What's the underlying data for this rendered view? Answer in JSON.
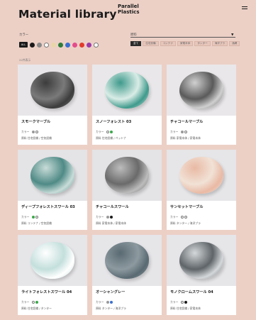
{
  "header": {
    "title": "Material library",
    "logo_line1": "Parallel",
    "logo_line2": "Plastics"
  },
  "filters": {
    "colors_label": "カラー",
    "all_label": "ALL",
    "swatches": [
      "#1a1a1a",
      "#8a8a8a",
      "#ffffff",
      "#e8d6a8",
      "#2e7d3a",
      "#3b6fd0",
      "#e44c8c",
      "#e23a2b",
      "#9b3aa8",
      "#ffffff"
    ],
    "material_label": "原料",
    "material_chips": [
      "全て",
      "住宅設備",
      "コンテナ",
      "家電本体",
      "タンター",
      "海洋プラ",
      "漁網"
    ],
    "result_count": "22件表示"
  },
  "cards": [
    {
      "name": "スモークマーブル",
      "color_label": "カラー",
      "dots": [
        "#999999",
        "#ffffff"
      ],
      "material": "原料  住宅設備 / 空気設備",
      "stone": "#7a7a7a",
      "stone2": "#3c3c3c",
      "bg": "#e8e6e9"
    },
    {
      "name": "スノーフォレスト 03",
      "color_label": "カラー",
      "dots": [
        "#ffffff",
        "#3aa84a"
      ],
      "material": "原料  住宅設備 / ペットナ",
      "stone": "#d9ece6",
      "stone2": "#3f9a8c",
      "bg": "#e9e7e9"
    },
    {
      "name": "チャコールマーブル",
      "color_label": "カラー",
      "dots": [
        "#999999",
        "#ffffff"
      ],
      "material": "原料  家電本体 / 家電本体",
      "stone": "#5a5a5a",
      "stone2": "#d0d0d0",
      "bg": "#e9e7e9"
    },
    {
      "name": "ディープフォレストスワール 03",
      "color_label": "カラー",
      "dots": [
        "#3aa84a",
        "#ffffff"
      ],
      "material": "原料  コンテナ / 空気設備",
      "stone": "#4f8a86",
      "stone2": "#c8dcd8",
      "bg": "#e4e3e6"
    },
    {
      "name": "チャコールスワール",
      "color_label": "カラー",
      "dots": [
        "#999999",
        "#1a1a1a"
      ],
      "material": "原料  家電本体 / 家電本体",
      "stone": "#6a6a6a",
      "stone2": "#bcbcbc",
      "bg": "#e4e3e6"
    },
    {
      "name": "サンセットマーブル",
      "color_label": "カラー",
      "dots": [
        "#ffffff",
        "#ffffff"
      ],
      "material": "原料  タンター / 海洋プラ",
      "stone": "#f1e2d6",
      "stone2": "#e9b9a4",
      "bg": "#e6e5e8"
    },
    {
      "name": "ライトフォレストスワール 04",
      "color_label": "カラー",
      "dots": [
        "#ffffff",
        "#3aa84a"
      ],
      "material": "原料  住宅設備 / タンター",
      "stone": "#c3dfdc",
      "stone2": "#ffffff",
      "bg": "#e6e5e8"
    },
    {
      "name": "オーシャングレー",
      "color_label": "カラー",
      "dots": [
        "#999999",
        "#3b6fd0"
      ],
      "material": "原料  タンター / 海洋プラ",
      "stone": "#8d9aa0",
      "stone2": "#5a6a72",
      "bg": "#e6e5e8"
    },
    {
      "name": "モノクロームスワール 04",
      "color_label": "カラー",
      "dots": [
        "#ffffff",
        "#1a1a1a"
      ],
      "material": "原料  住宅設備 / 家電本体",
      "stone": "#5e6468",
      "stone2": "#d5d8da",
      "bg": "#e6e5e8"
    }
  ]
}
